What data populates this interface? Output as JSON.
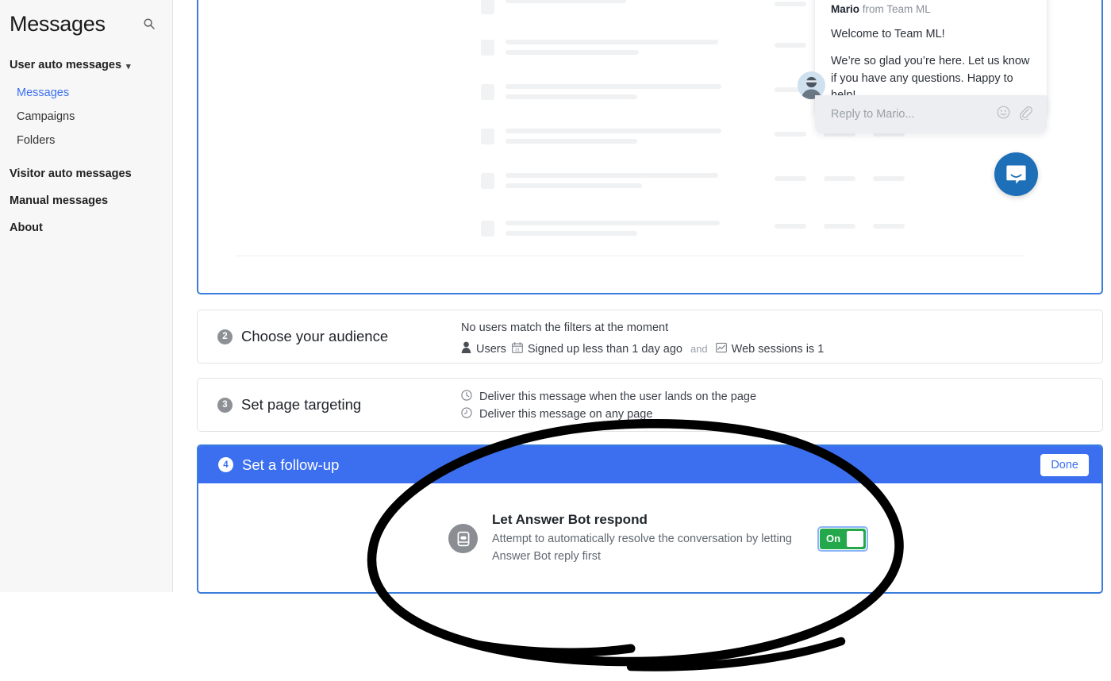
{
  "sidebar": {
    "title": "Messages",
    "search_icon": "search-icon",
    "group": {
      "label": "User auto messages",
      "chevron": "chevron-down-icon",
      "items": [
        {
          "label": "Messages",
          "active": true
        },
        {
          "label": "Campaigns",
          "active": false
        },
        {
          "label": "Folders",
          "active": false
        }
      ]
    },
    "items": [
      {
        "label": "Visitor auto messages"
      },
      {
        "label": "Manual messages"
      },
      {
        "label": "About"
      }
    ]
  },
  "preview": {
    "message": {
      "sender_name": "Mario",
      "sender_suffix": " from Team ML",
      "paragraphs": [
        "Welcome to Team ML!",
        "We’re so glad you’re here. Let us know if you have any questions. Happy to help!"
      ]
    },
    "composer": {
      "placeholder": "Reply to Mario...",
      "emoji_icon": "emoji-smiley-icon",
      "attach_icon": "paperclip-icon"
    },
    "launcher_icon": "intercom-chat-launcher-icon",
    "avatar": "sender-avatar"
  },
  "steps": [
    {
      "number": "2",
      "title": "Choose your audience",
      "note": "No users match the filters at the moment",
      "filters": [
        {
          "icon": "person-icon",
          "label": "Users"
        },
        {
          "icon": "calendar-icon",
          "label": "Signed up less than 1 day ago"
        },
        {
          "icon": "chart-icon",
          "label": "Web sessions is 1"
        }
      ],
      "conjunction": "and"
    },
    {
      "number": "3",
      "title": "Set page targeting",
      "lines": [
        {
          "icon": "clock-icon",
          "label": "Deliver this message when the user lands on the page"
        },
        {
          "icon": "clock-alt-icon",
          "label": "Deliver this message on any page"
        }
      ]
    }
  ],
  "step4": {
    "number": "4",
    "title": "Set a follow-up",
    "done_label": "Done",
    "option": {
      "icon": "answer-bot-icon",
      "title": "Let Answer Bot respond",
      "description": "Attempt to automatically resolve the conversation by letting Answer Bot reply first",
      "toggle_state": "On"
    }
  },
  "colors": {
    "accent_blue": "#3b6ff0",
    "preview_border": "#3b7ddd",
    "toggle_green": "#23a94c",
    "focus_ring": "#8ab4f8",
    "badge_gray": "#8d9196",
    "launcher_blue": "#1d6fb8",
    "annotation": "#000000"
  },
  "annotation": {
    "shape": "hand-drawn-ellipse",
    "target": "let-answer-bot-respond-toggle"
  }
}
